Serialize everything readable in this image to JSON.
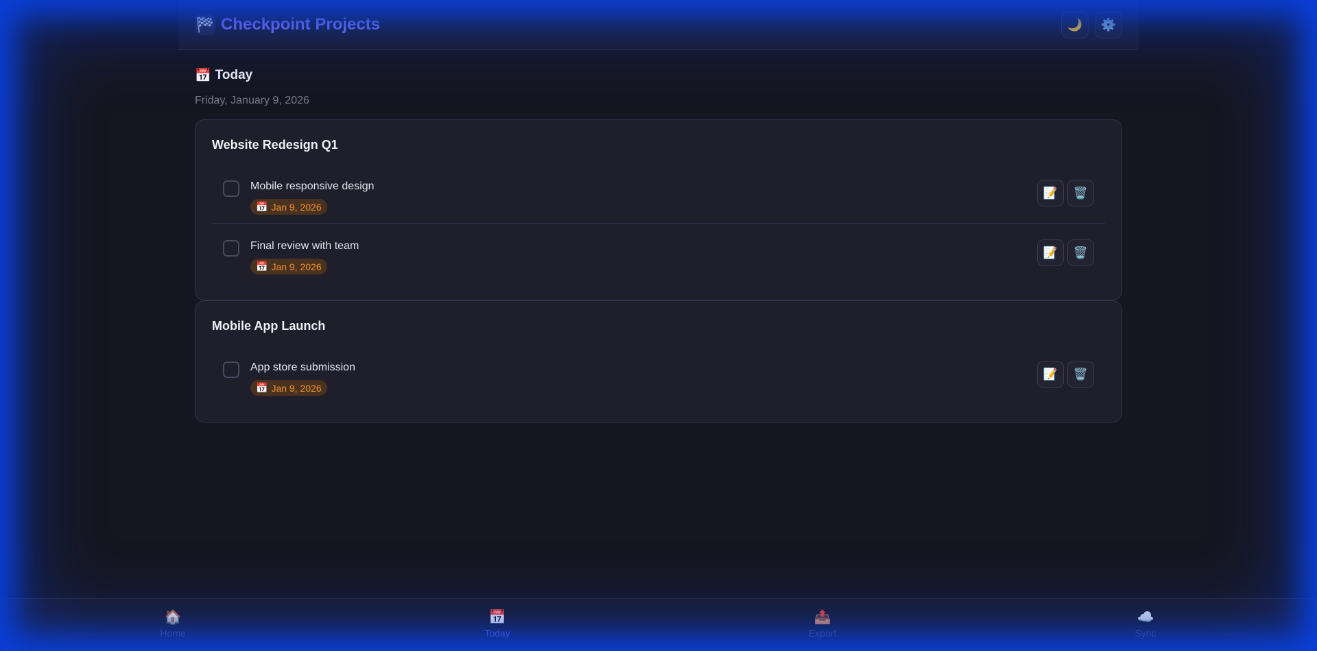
{
  "app": {
    "title": "Checkpoint Projects",
    "brand_icon": "checkered-flag-icon",
    "accent_color": "#8a73f0"
  },
  "header": {
    "theme_toggle_icon": "🌙",
    "settings_icon": "⚙️"
  },
  "page": {
    "title_icon": "📅",
    "title": "Today",
    "date": "Friday, January 9, 2026"
  },
  "projects": [
    {
      "name": "Website Redesign Q1",
      "tasks": [
        {
          "title": "Mobile responsive design",
          "due": "Jan 9, 2026"
        },
        {
          "title": "Final review with team",
          "due": "Jan 9, 2026"
        }
      ]
    },
    {
      "name": "Mobile App Launch",
      "tasks": [
        {
          "title": "App store submission",
          "due": "Jan 9, 2026"
        }
      ]
    }
  ],
  "task_actions": {
    "edit_icon": "📝",
    "delete_icon": "🗑️",
    "due_icon": "📅"
  },
  "bottom_nav": {
    "items": [
      {
        "icon": "🏠",
        "label": "Home"
      },
      {
        "icon": "📅",
        "label": "Today"
      },
      {
        "icon": "📤",
        "label": "Export"
      },
      {
        "icon": "☁️",
        "label": "Sync"
      }
    ],
    "active": "Today",
    "active_color": "#6d72f0"
  }
}
